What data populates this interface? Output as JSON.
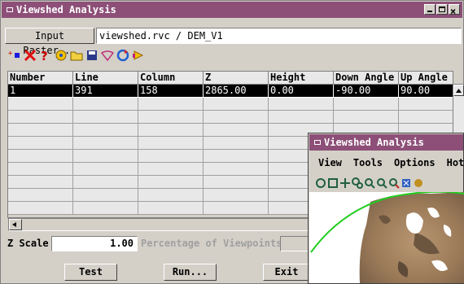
{
  "main_window": {
    "title": "Viewshed Analysis",
    "input_raster_button": "Input Raster...",
    "input_raster_value": "viewshed.rvc / DEM_V1",
    "table": {
      "columns": [
        "Number",
        "Line",
        "Column",
        "Z",
        "Height",
        "Down Angle",
        "Up Angle"
      ],
      "rows": [
        [
          "1",
          "391",
          "158",
          "2865.00",
          "0.00",
          "-90.00",
          "90.00"
        ]
      ]
    },
    "z_scale_label": "Z Scale",
    "z_scale_value": "1.00",
    "percentage_label": "Percentage of Viewpoints",
    "buttons": {
      "test": "Test",
      "run": "Run...",
      "exit": "Exit"
    }
  },
  "second_window": {
    "title": "Viewshed Analysis",
    "menu": [
      "View",
      "Tools",
      "Options",
      "Hotk"
    ]
  },
  "colors": {
    "titlebar": "#8d4f78",
    "selected_row": "#000000",
    "viewshed_line": "#22cc22"
  }
}
